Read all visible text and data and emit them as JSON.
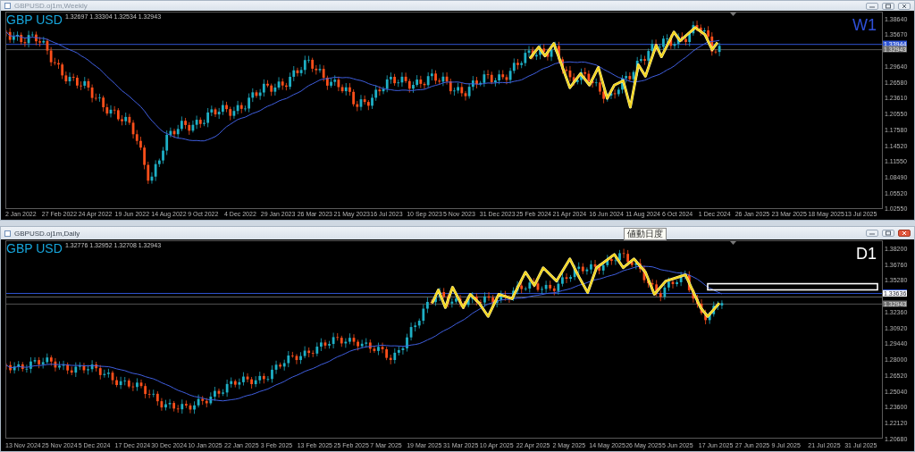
{
  "windows": [
    {
      "title": "GBPUSD.oj1m,Weekly",
      "focused": false,
      "info": "1.32697 1.33304 1.32534 1.32943",
      "symbol": "GBP USD",
      "timeframe": {
        "text": "W1",
        "color": "#2f4fd8"
      },
      "y_ticks": [
        "1.38640",
        "1.35670",
        "1.29640",
        "1.26580",
        "1.23610",
        "1.20550",
        "1.17580",
        "1.14520",
        "1.11550",
        "1.08490",
        "1.05520",
        "1.02550"
      ],
      "price_tags": [
        {
          "text": "1.33944",
          "kind": "line"
        },
        {
          "text": "1.32943",
          "kind": "bid"
        }
      ],
      "x_ticks": [
        "2 Jan 2022",
        "27 Feb 2022",
        "24 Apr 2022",
        "19 Jun 2022",
        "14 Aug 2022",
        "9 Oct 2022",
        "4 Dec 2022",
        "29 Jan 2023",
        "26 Mar 2023",
        "21 May 2023",
        "16 Jul 2023",
        "10 Sep 2023",
        "5 Nov 2023",
        "31 Dec 2023",
        "25 Feb 2024",
        "21 Apr 2024",
        "16 Jun 2024",
        "11 Aug 2024",
        "6 Oct 2024",
        "1 Dec 2024",
        "26 Jan 2025",
        "23 Mar 2025",
        "18 May 2025",
        "13 Jul 2025"
      ]
    },
    {
      "title": "GBPUSD.oj1m,Daily",
      "focused": true,
      "tooltip": "値動日度",
      "info": "1.32776 1.32952 1.32708 1.32943",
      "symbol": "GBP USD",
      "timeframe": {
        "text": "D1",
        "color": "#ffffff"
      },
      "y_ticks": [
        "1.38200",
        "1.36760",
        "1.35280",
        "1.32360",
        "1.30920",
        "1.29440",
        "1.28000",
        "1.26520",
        "1.25040",
        "1.23600",
        "1.22120",
        "1.20680"
      ],
      "price_tags": [
        {
          "text": "1.33636",
          "kind": "line"
        },
        {
          "text": "1.32943",
          "kind": "bid"
        }
      ],
      "x_ticks": [
        "13 Nov 2024",
        "25 Nov 2024",
        "5 Dec 2024",
        "17 Dec 2024",
        "30 Dec 2024",
        "10 Jan 2025",
        "22 Jan 2025",
        "3 Feb 2025",
        "13 Feb 2025",
        "25 Feb 2025",
        "7 Mar 2025",
        "19 Mar 2025",
        "31 Mar 2025",
        "10 Apr 2025",
        "22 Apr 2025",
        "2 May 2025",
        "14 May 2025",
        "26 May 2025",
        "5 Jun 2025",
        "17 Jun 2025",
        "27 Jun 2025",
        "9 Jul 2025",
        "21 Jul 2025",
        "31 Jul 2025"
      ]
    }
  ]
}
